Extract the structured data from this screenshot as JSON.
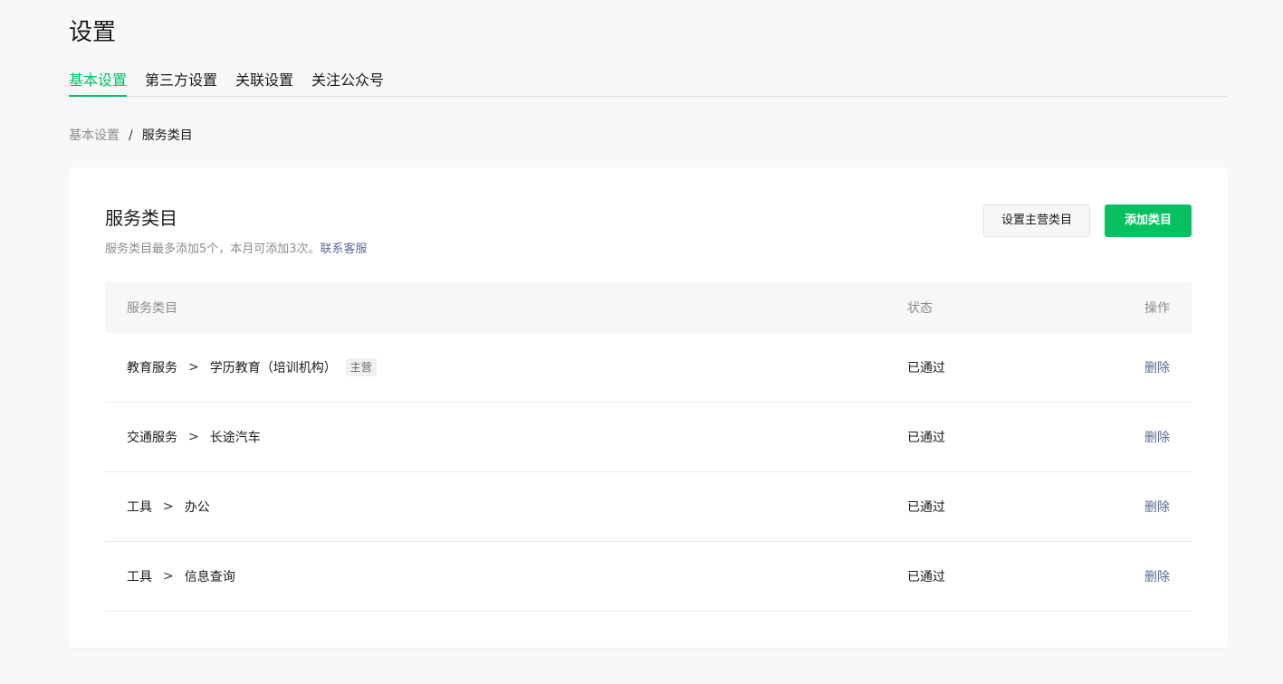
{
  "page": {
    "title": "设置"
  },
  "tabs": [
    {
      "label": "基本设置",
      "active": true
    },
    {
      "label": "第三方设置",
      "active": false
    },
    {
      "label": "关联设置",
      "active": false
    },
    {
      "label": "关注公众号",
      "active": false
    }
  ],
  "breadcrumb": {
    "parent": "基本设置",
    "separator": "/",
    "current": "服务类目"
  },
  "card": {
    "title": "服务类目",
    "description": "服务类目最多添加5个，本月可添加3次。",
    "contact_link": "联系客服",
    "buttons": {
      "set_main": "设置主营类目",
      "add": "添加类目"
    }
  },
  "table": {
    "headers": {
      "category": "服务类目",
      "status": "状态",
      "action": "操作"
    },
    "rows": [
      {
        "parent": "教育服务",
        "sep": ">",
        "child": "学历教育（培训机构）",
        "tag": "主营",
        "status": "已通过",
        "action": "删除"
      },
      {
        "parent": "交通服务",
        "sep": ">",
        "child": "长途汽车",
        "tag": "",
        "status": "已通过",
        "action": "删除"
      },
      {
        "parent": "工具",
        "sep": ">",
        "child": "办公",
        "tag": "",
        "status": "已通过",
        "action": "删除"
      },
      {
        "parent": "工具",
        "sep": ">",
        "child": "信息查询",
        "tag": "",
        "status": "已通过",
        "action": "删除"
      }
    ]
  },
  "colors": {
    "accent": "#07c160",
    "link": "#576b95",
    "muted": "#8c8c8c",
    "background": "#f7f8fa"
  }
}
